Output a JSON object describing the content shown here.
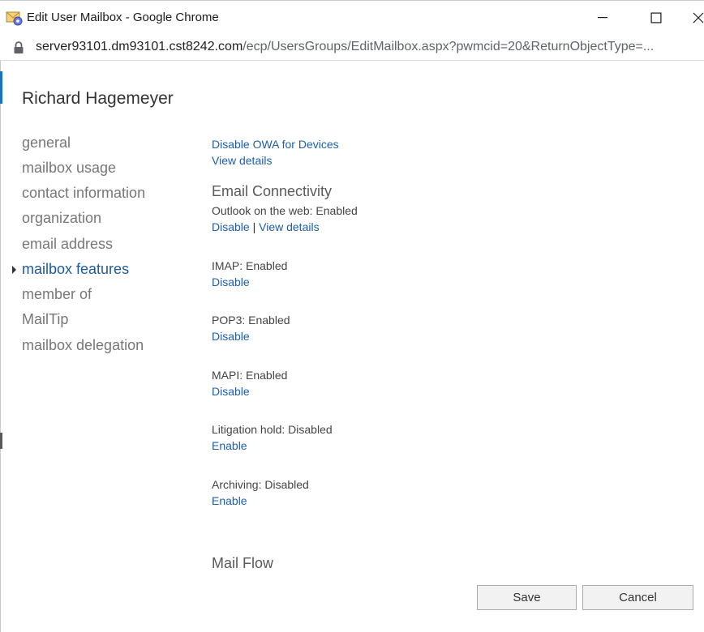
{
  "window": {
    "title": "Edit User Mailbox - Google Chrome"
  },
  "address": {
    "host": "server93101.dm93101.cst8242.com",
    "path": "/ecp/UsersGroups/EditMailbox.aspx?pwmcid=20&ReturnObjectType=..."
  },
  "page": {
    "title": "Richard Hagemeyer"
  },
  "nav": {
    "items": [
      {
        "label": "general"
      },
      {
        "label": "mailbox usage"
      },
      {
        "label": "contact information"
      },
      {
        "label": "organization"
      },
      {
        "label": "email address"
      },
      {
        "label": "mailbox features"
      },
      {
        "label": "member of"
      },
      {
        "label": "MailTip"
      },
      {
        "label": "mailbox delegation"
      }
    ],
    "active_index": 5
  },
  "main": {
    "owa_devices": {
      "disable_link": "Disable OWA for Devices",
      "view_details": "View details"
    },
    "email_connectivity": {
      "heading": "Email Connectivity",
      "owa_status": "Outlook on the web: Enabled",
      "owa_disable": "Disable",
      "separator": "|",
      "owa_view_details": "View details",
      "imap_status": "IMAP: Enabled",
      "imap_disable": "Disable",
      "pop3_status": "POP3: Enabled",
      "pop3_disable": "Disable",
      "mapi_status": "MAPI: Enabled",
      "mapi_disable": "Disable",
      "litigation_status": "Litigation hold: Disabled",
      "litigation_enable": "Enable",
      "archiving_status": "Archiving: Disabled",
      "archiving_enable": "Enable"
    },
    "mail_flow": {
      "heading": "Mail Flow"
    }
  },
  "footer": {
    "save_label": "Save",
    "cancel_label": "Cancel"
  },
  "colors": {
    "link": "#1e5fa8",
    "active_nav": "#1e5a9a",
    "nav_text": "#777777"
  }
}
